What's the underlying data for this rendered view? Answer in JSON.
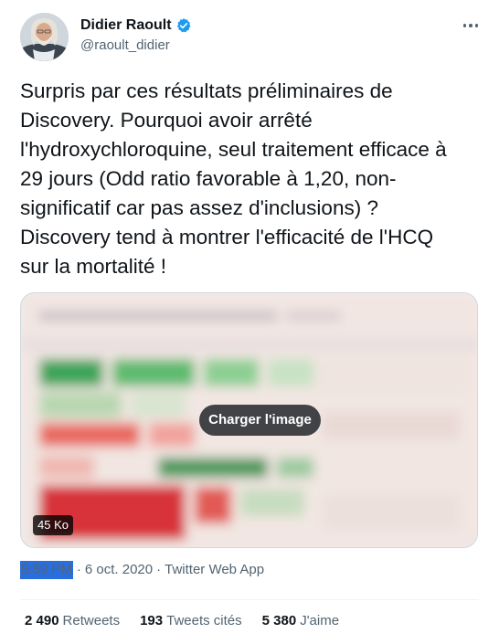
{
  "author": {
    "name": "Didier Raoult",
    "handle": "@raoult_didier",
    "verified": true
  },
  "tweet": {
    "text": "Surpris par ces résultats préliminaires de\nDiscovery. Pourquoi avoir arrêté\nl'hydroxychloroquine, seul traitement efficace à\n29 jours (Odd ratio favorable à 1,20, non-\nsignificatif car pas assez d'inclusions) ?\nDiscovery tend à montrer l'efficacité de l'HCQ\nsur la mortalité !"
  },
  "media": {
    "load_label": "Charger l'image",
    "size_label": "45 Ko"
  },
  "meta": {
    "time": "5:59 PM",
    "separator": "·",
    "date": "6 oct. 2020",
    "source": "Twitter Web App"
  },
  "stats": {
    "retweets_count": "2 490",
    "retweets_label": "Retweets",
    "quotes_count": "193",
    "quotes_label": "Tweets cités",
    "likes_count": "5 380",
    "likes_label": "J'aime"
  },
  "colors": {
    "text": "#0f1419",
    "secondary": "#536471",
    "verified_blue": "#1d9bf0",
    "border": "#cfd9de",
    "selection": "#2a6edd"
  }
}
